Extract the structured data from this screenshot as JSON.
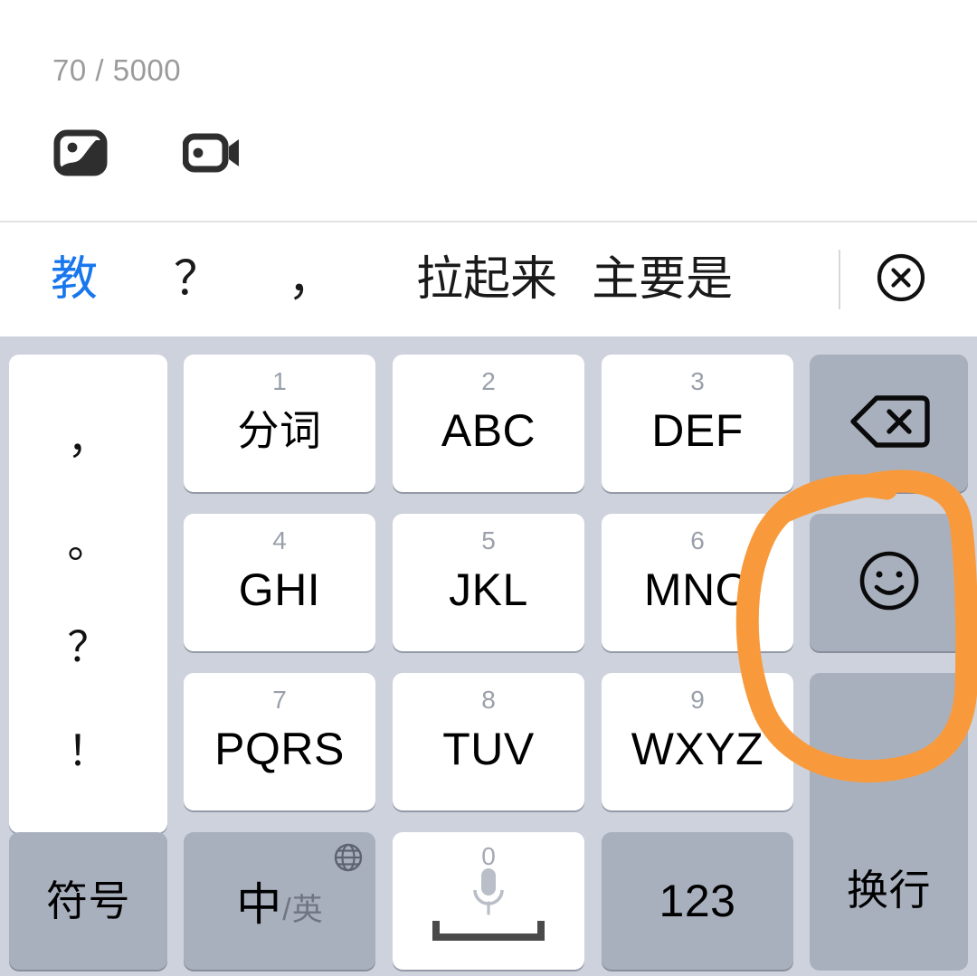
{
  "compose": {
    "char_counter": "70 / 5000",
    "attachments": [
      {
        "name": "image-attach-icon",
        "label": "image"
      },
      {
        "name": "video-attach-icon",
        "label": "video"
      }
    ]
  },
  "candidate_bar": {
    "candidates": [
      {
        "text": "教",
        "selected": true
      },
      {
        "text": "？",
        "selected": false
      },
      {
        "text": "，",
        "selected": false
      },
      {
        "text": "拉起来",
        "selected": false
      },
      {
        "text": "主要是",
        "selected": false
      }
    ],
    "close_label": "关闭",
    "close_icon": "circle-x-icon"
  },
  "keyboard": {
    "punctuation_key": {
      "name": "punctuation-key",
      "marks": [
        "，",
        "。",
        "？",
        "！"
      ]
    },
    "keys": [
      {
        "digit": "1",
        "label": "分词",
        "cjk": true,
        "name": "key-1-fenci"
      },
      {
        "digit": "2",
        "label": "ABC",
        "cjk": false,
        "name": "key-2-abc"
      },
      {
        "digit": "3",
        "label": "DEF",
        "cjk": false,
        "name": "key-3-def"
      },
      {
        "digit": "4",
        "label": "GHI",
        "cjk": false,
        "name": "key-4-ghi"
      },
      {
        "digit": "5",
        "label": "JKL",
        "cjk": false,
        "name": "key-5-jkl"
      },
      {
        "digit": "6",
        "label": "MNO",
        "cjk": false,
        "name": "key-6-mno"
      },
      {
        "digit": "7",
        "label": "PQRS",
        "cjk": false,
        "name": "key-7-pqrs"
      },
      {
        "digit": "8",
        "label": "TUV",
        "cjk": false,
        "name": "key-8-tuv"
      },
      {
        "digit": "9",
        "label": "WXYZ",
        "cjk": false,
        "name": "key-9-wxyz"
      }
    ],
    "function_keys": {
      "backspace": {
        "label": "",
        "icon": "backspace-icon"
      },
      "emoji": {
        "label": "",
        "icon": "smiley-face-icon"
      },
      "enter": {
        "label": "换行"
      },
      "symbols": {
        "label": "符号"
      },
      "lang_toggle": {
        "zh": "中",
        "slash": "/",
        "en": "英",
        "icon": "globe-icon"
      },
      "space": {
        "digit": "0",
        "mic_icon": "microphone-icon",
        "space_icon": "space-bar-icon"
      },
      "numeric": {
        "label": "123"
      }
    }
  },
  "annotation": {
    "shape": "hand-drawn-ellipse",
    "color": "#f89a3c",
    "target": "emoji-key"
  },
  "colors": {
    "accent_blue": "#1877ed",
    "keyboard_bg": "#ced2dc",
    "function_key": "#a9b0bd",
    "letter_key": "#ffffff",
    "annotation_orange": "#f89a3c",
    "counter_gray": "#9b9b9b"
  }
}
